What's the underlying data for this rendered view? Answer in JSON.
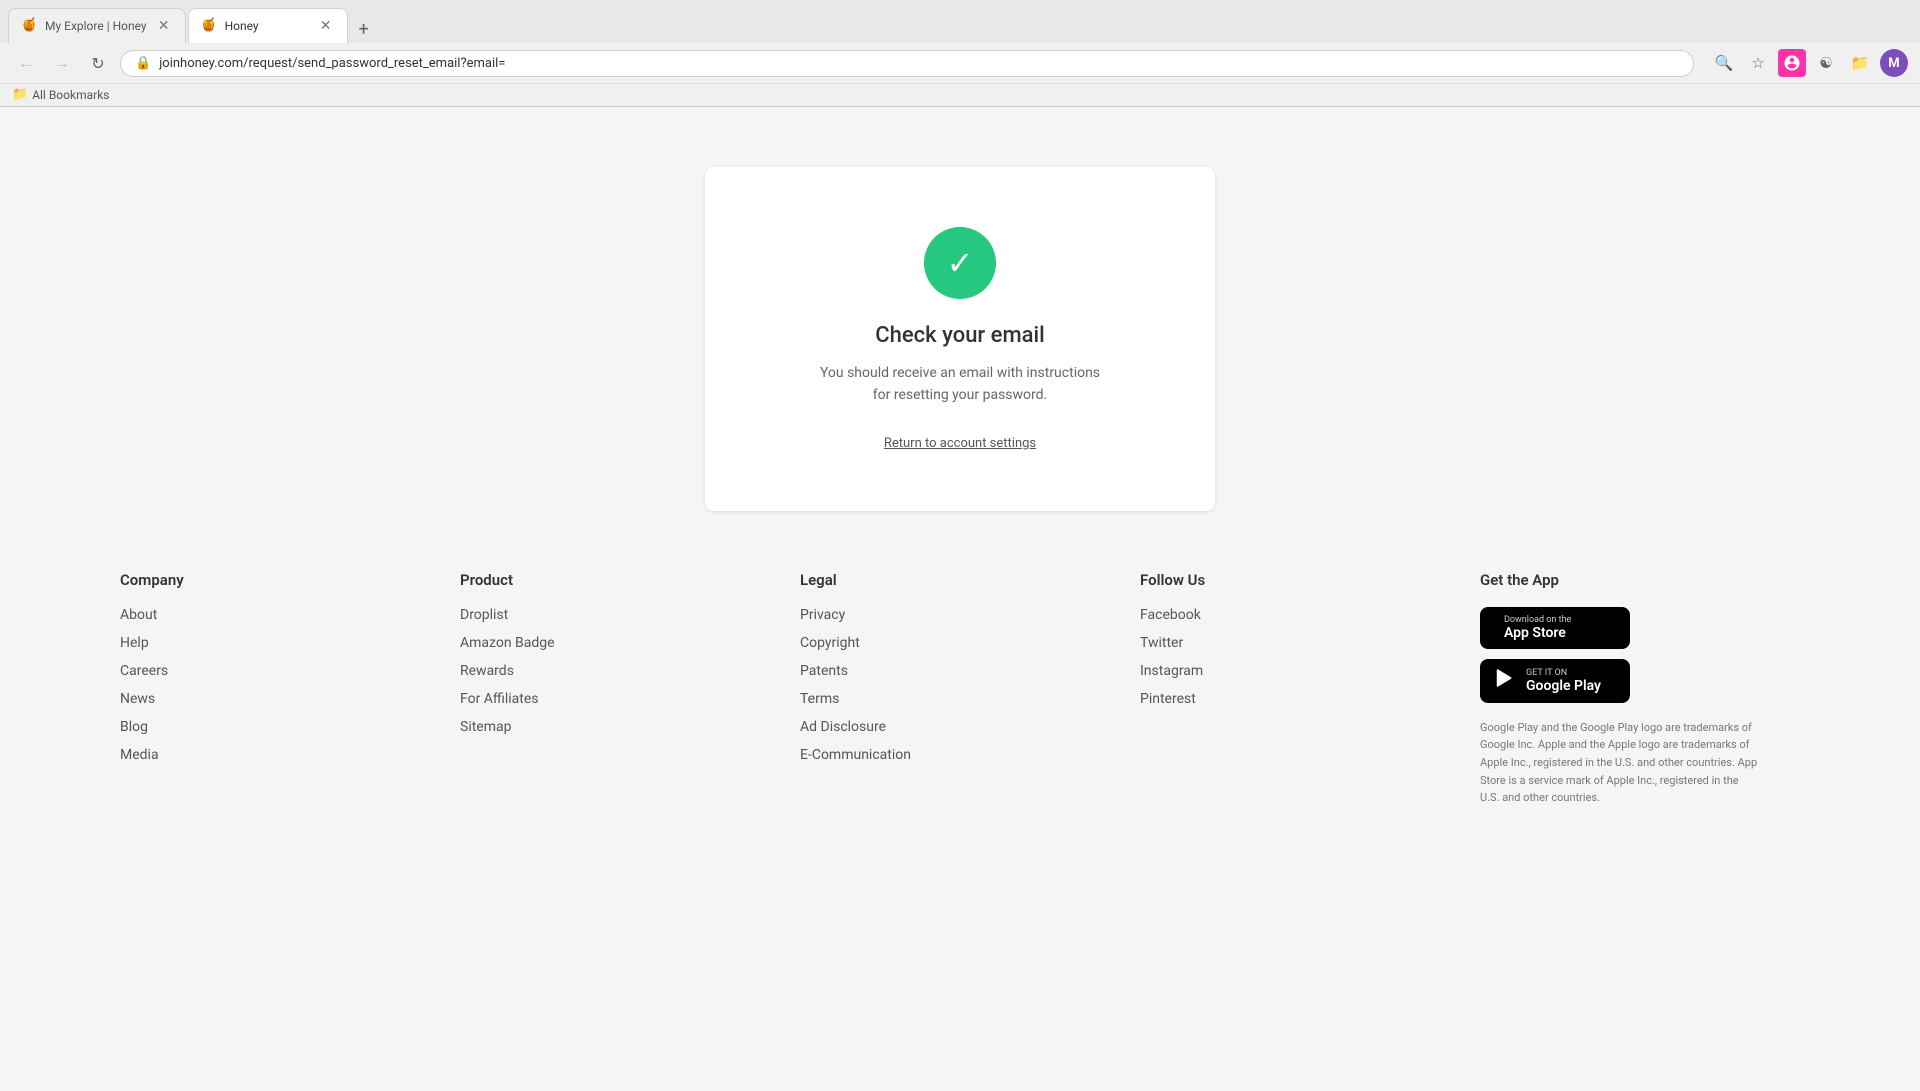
{
  "browser": {
    "tabs": [
      {
        "id": "tab1",
        "title": "My Explore | Honey",
        "favicon": "🍯",
        "active": false,
        "url": ""
      },
      {
        "id": "tab2",
        "title": "Honey",
        "favicon": "🍯",
        "active": true,
        "url": "joinhoney.com/request/send_password_reset_email?email="
      }
    ],
    "new_tab_label": "+",
    "address": "joinhoney.com/request/send_password_reset_email?email=",
    "bookmarks_label": "All Bookmarks"
  },
  "card": {
    "title": "Check your email",
    "subtitle_line1": "You should receive an email with instructions",
    "subtitle_line2": "for resetting your password.",
    "return_link": "Return to account settings"
  },
  "footer": {
    "company": {
      "heading": "Company",
      "links": [
        "About",
        "Help",
        "Careers",
        "News",
        "Blog",
        "Media"
      ]
    },
    "product": {
      "heading": "Product",
      "links": [
        "Droplist",
        "Amazon Badge",
        "Rewards",
        "For Affiliates",
        "Sitemap"
      ]
    },
    "legal": {
      "heading": "Legal",
      "links": [
        "Privacy",
        "Copyright",
        "Patents",
        "Terms",
        "Ad Disclosure",
        "E-Communication"
      ]
    },
    "follow": {
      "heading": "Follow Us",
      "links": [
        "Facebook",
        "Twitter",
        "Instagram",
        "Pinterest"
      ]
    },
    "app": {
      "heading": "Get the App",
      "apple_small": "Download on the",
      "apple_large": "App Store",
      "google_small": "GET IT ON",
      "google_large": "Google Play",
      "disclaimer": "Google Play and the Google Play logo are trademarks of Google Inc. Apple and the Apple logo are trademarks of Apple Inc., registered in the U.S. and other countries. App Store is a service mark of Apple Inc., registered in the U.S. and other countries."
    }
  }
}
